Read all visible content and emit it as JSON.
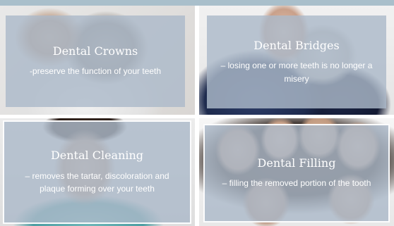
{
  "services": [
    {
      "title": "Dental Crowns",
      "description": "-preserve the function of your teeth",
      "photo_icon": "couple-photo-icon"
    },
    {
      "title": "Dental Bridges",
      "description": "– losing one or more teeth is no longer a misery",
      "photo_icon": "elderly-couple-photo-icon"
    },
    {
      "title": "Dental Cleaning",
      "description": "– removes the tartar, discoloration and plaque forming over your teeth",
      "photo_icon": "patient-photo-icon"
    },
    {
      "title": "Dental Filling",
      "description": "– filling the removed portion of the tooth",
      "photo_icon": "group-photo-icon"
    }
  ],
  "colors": {
    "overlay": "#acbac9",
    "top_bar": "#a9bfcb",
    "text": "#ffffff"
  }
}
